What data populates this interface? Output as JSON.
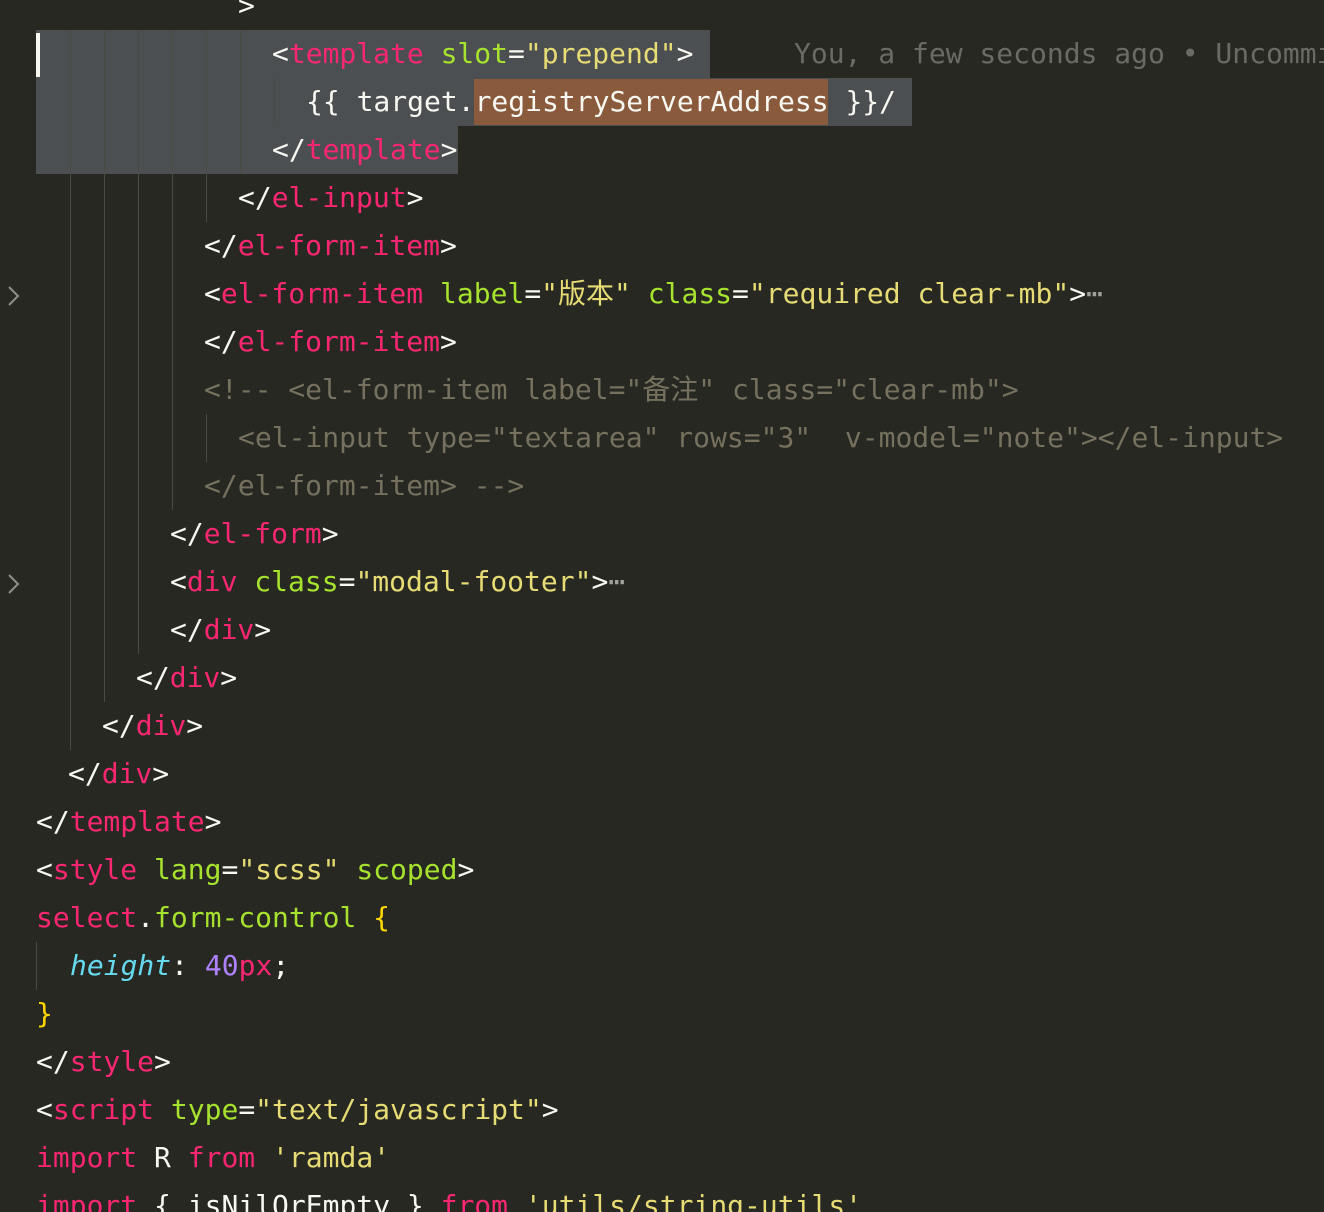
{
  "editor": {
    "blame_annotation": "You, a few seconds ago • Uncommi",
    "lines": [
      [
        [
          ">",
          "p"
        ]
      ],
      [
        [
          "<",
          "p"
        ],
        [
          "template",
          "t"
        ],
        [
          " ",
          "p"
        ],
        [
          "slot",
          "a"
        ],
        [
          "=",
          "p"
        ],
        [
          "\"prepend\"",
          "s"
        ],
        [
          ">",
          "p"
        ]
      ],
      [
        [
          "{{ target.",
          "p"
        ],
        [
          "registryServerAddress",
          "p"
        ],
        [
          " }}/",
          "p"
        ]
      ],
      [
        [
          "</",
          "p"
        ],
        [
          "template",
          "t"
        ],
        [
          ">",
          "p"
        ]
      ],
      [
        [
          "</",
          "p"
        ],
        [
          "el-input",
          "t"
        ],
        [
          ">",
          "p"
        ]
      ],
      [
        [
          "</",
          "p"
        ],
        [
          "el-form-item",
          "t"
        ],
        [
          ">",
          "p"
        ]
      ],
      [
        [
          "<",
          "p"
        ],
        [
          "el-form-item",
          "t"
        ],
        [
          " ",
          "p"
        ],
        [
          "label",
          "a"
        ],
        [
          "=",
          "p"
        ],
        [
          "\"版本\"",
          "s"
        ],
        [
          " ",
          "p"
        ],
        [
          "class",
          "a"
        ],
        [
          "=",
          "p"
        ],
        [
          "\"required clear-mb\"",
          "s"
        ],
        [
          ">",
          "p"
        ],
        [
          "⋯",
          "e"
        ]
      ],
      [
        [
          "</",
          "p"
        ],
        [
          "el-form-item",
          "t"
        ],
        [
          ">",
          "p"
        ]
      ],
      [
        [
          "<!-- <el-form-item label=\"备注\" class=\"clear-mb\">",
          "c"
        ]
      ],
      [
        [
          "<el-input type=\"textarea\" rows=\"3\"  v-model=\"note\"></el-input>",
          "c"
        ]
      ],
      [
        [
          "</el-form-item> -->",
          "c"
        ]
      ],
      [
        [
          "</",
          "p"
        ],
        [
          "el-form",
          "t"
        ],
        [
          ">",
          "p"
        ]
      ],
      [
        [
          "<",
          "p"
        ],
        [
          "div",
          "t"
        ],
        [
          " ",
          "p"
        ],
        [
          "class",
          "a"
        ],
        [
          "=",
          "p"
        ],
        [
          "\"modal-footer\"",
          "s"
        ],
        [
          ">",
          "p"
        ],
        [
          "⋯",
          "e"
        ]
      ],
      [
        [
          "</",
          "p"
        ],
        [
          "div",
          "t"
        ],
        [
          ">",
          "p"
        ]
      ],
      [
        [
          "</",
          "p"
        ],
        [
          "div",
          "t"
        ],
        [
          ">",
          "p"
        ]
      ],
      [
        [
          "</",
          "p"
        ],
        [
          "div",
          "t"
        ],
        [
          ">",
          "p"
        ]
      ],
      [
        [
          "</",
          "p"
        ],
        [
          "div",
          "t"
        ],
        [
          ">",
          "p"
        ]
      ],
      [
        [
          "</",
          "p"
        ],
        [
          "template",
          "t"
        ],
        [
          ">",
          "p"
        ]
      ],
      [
        [
          "<",
          "p"
        ],
        [
          "style",
          "t"
        ],
        [
          " ",
          "p"
        ],
        [
          "lang",
          "a"
        ],
        [
          "=",
          "p"
        ],
        [
          "\"scss\"",
          "s"
        ],
        [
          " ",
          "p"
        ],
        [
          "scoped",
          "a"
        ],
        [
          ">",
          "p"
        ]
      ],
      [
        [
          "select",
          "t"
        ],
        [
          ".",
          "p"
        ],
        [
          "form-control",
          "a"
        ],
        [
          " ",
          "p"
        ],
        [
          "{",
          "b"
        ]
      ],
      [
        [
          "height",
          "i"
        ],
        [
          ": ",
          "p"
        ],
        [
          "40",
          "n"
        ],
        [
          "px",
          "t"
        ],
        [
          ";",
          "p"
        ]
      ],
      [
        [
          "}",
          "b"
        ]
      ],
      [
        [
          "</",
          "p"
        ],
        [
          "style",
          "t"
        ],
        [
          ">",
          "p"
        ]
      ],
      [
        [
          "<",
          "p"
        ],
        [
          "script",
          "t"
        ],
        [
          " ",
          "p"
        ],
        [
          "type",
          "a"
        ],
        [
          "=",
          "p"
        ],
        [
          "\"text/javascript\"",
          "s"
        ],
        [
          ">",
          "p"
        ]
      ],
      [
        [
          "import",
          "t"
        ],
        [
          " R ",
          "p"
        ],
        [
          "from",
          "t"
        ],
        [
          " ",
          "p"
        ],
        [
          "'ramda'",
          "s"
        ]
      ],
      [
        [
          "import",
          "t"
        ],
        [
          " { isNilOrEmpty } ",
          "p"
        ],
        [
          "from",
          "t"
        ],
        [
          " ",
          "p"
        ],
        [
          "'utils/string-utils'",
          "s"
        ]
      ]
    ]
  }
}
